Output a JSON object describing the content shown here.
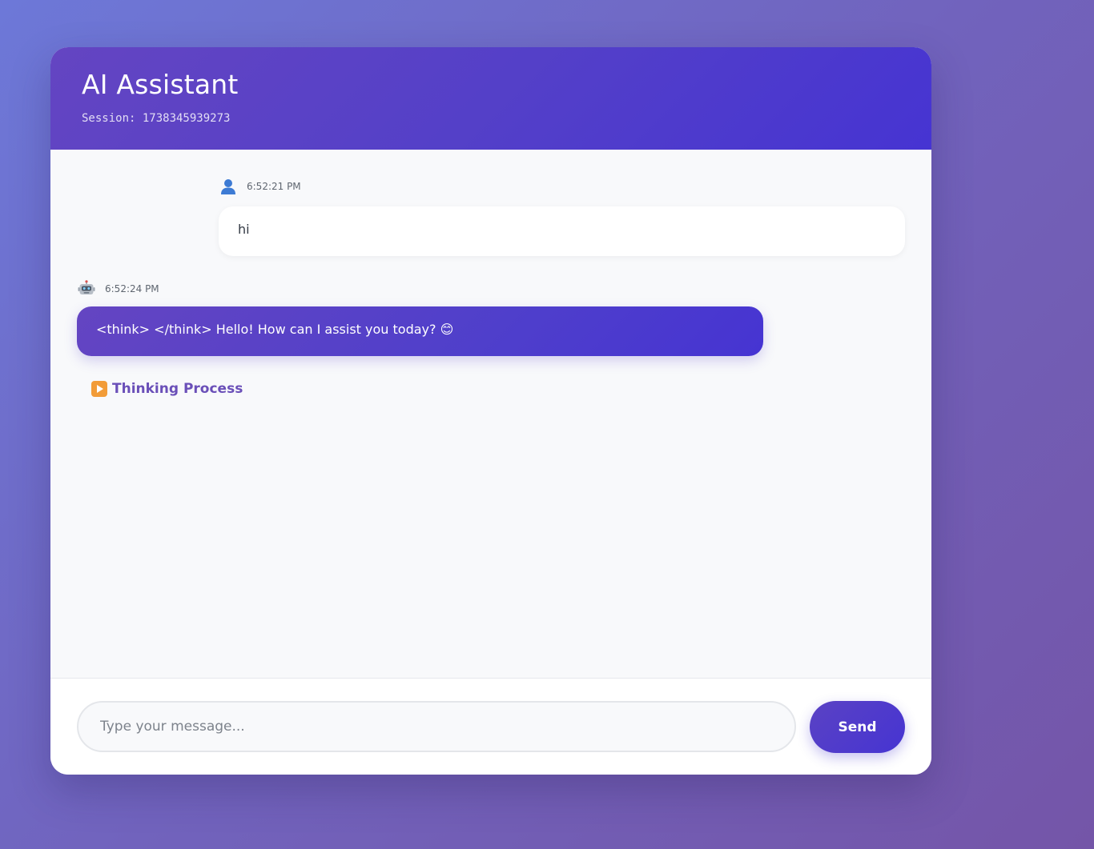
{
  "header": {
    "title": "AI Assistant",
    "session_label": "Session: 1738345939273"
  },
  "messages": [
    {
      "role": "user",
      "icon": "user-icon",
      "time": "6:52:21 PM",
      "text": "hi"
    },
    {
      "role": "assistant",
      "icon": "robot-icon",
      "time": "6:52:24 PM",
      "text": "<think> </think> Hello! How can I assist you today? 😊"
    }
  ],
  "thinking": {
    "icon": "play-icon",
    "label": "Thinking Process"
  },
  "composer": {
    "placeholder": "Type your message...",
    "value": "",
    "send_label": "Send"
  },
  "colors": {
    "accent": "#4634d2",
    "accent_start": "#6445c2",
    "thinking_label": "#6a4fb8",
    "play_icon": "#f29c38"
  }
}
